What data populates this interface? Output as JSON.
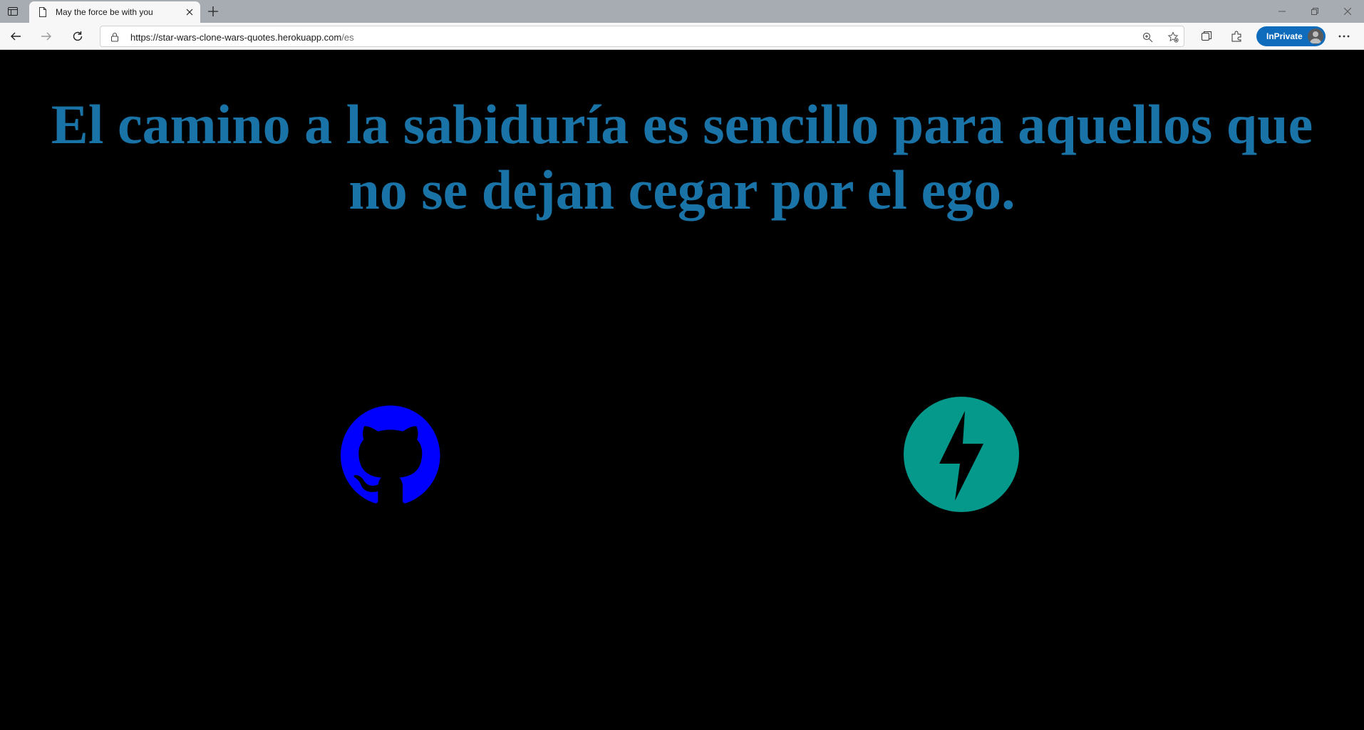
{
  "browser": {
    "tab_title": "May the force be with you",
    "url_host": "https://star-wars-clone-wars-quotes.herokuapp.com",
    "url_path": "/es",
    "inprivate_label": "InPrivate"
  },
  "page": {
    "quote": "El camino a la sabiduría es sencillo para aquellos que no se dejan cegar por el ego.",
    "quote_color": "#1a73a6",
    "links": [
      {
        "icon": "github-icon",
        "color": "#0000ff"
      },
      {
        "icon": "fastapi-icon",
        "color": "#05998b"
      }
    ]
  }
}
